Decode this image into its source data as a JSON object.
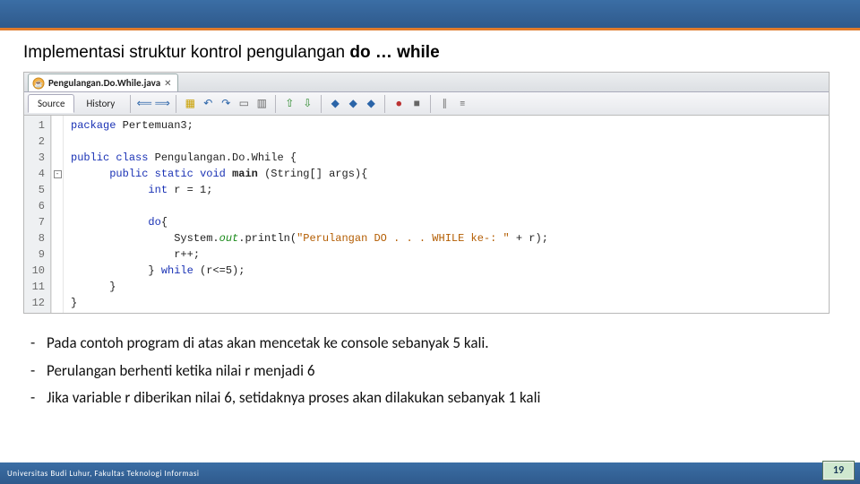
{
  "title": {
    "prefix": "Implementasi struktur kontrol pengulangan ",
    "bold": "do … while"
  },
  "ide": {
    "file_tab": {
      "icon": "java-icon",
      "name": "Pengulangan.Do.While.java"
    },
    "subtabs": {
      "source": "Source",
      "history": "History"
    },
    "gutter": [
      "1",
      "2",
      "3",
      "4",
      "5",
      "6",
      "7",
      "8",
      "9",
      "10",
      "11",
      "12"
    ],
    "fold": {
      "line4": "-"
    },
    "code": {
      "l1_package": "package",
      "l1_pkgname": " Pertemuan3;",
      "l3_public": "public",
      "l3_class": "class",
      "l3_name": " Pengulangan.Do.While {",
      "l4_pub": "public",
      "l4_stat": "static",
      "l4_void": "void",
      "l4_main": " main",
      "l4_par_open": " (String[] args){",
      "l5_int": "int",
      "l5_rest": " r = 1;",
      "l7_do": "do",
      "l7_brace": "{",
      "l8_sys": "System.",
      "l8_out": "out",
      "l8_print": ".println(",
      "l8_str": "\"Perulangan DO . . . WHILE ke-: \"",
      "l8_tail": " + r);",
      "l9": "r++;",
      "l10_close": "} ",
      "l10_while": "while",
      "l10_cond": " (r<=5);",
      "l11": "}",
      "l12": "}"
    }
  },
  "bullets": [
    "Pada contoh program di atas akan mencetak ke console sebanyak 5 kali.",
    "Perulangan berhenti ketika nilai r menjadi 6",
    "Jika variable r diberikan nilai 6, setidaknya proses akan dilakukan sebanyak 1 kali"
  ],
  "footer": "Universitas Budi Luhur, Fakultas Teknologi Informasi",
  "page": "19"
}
